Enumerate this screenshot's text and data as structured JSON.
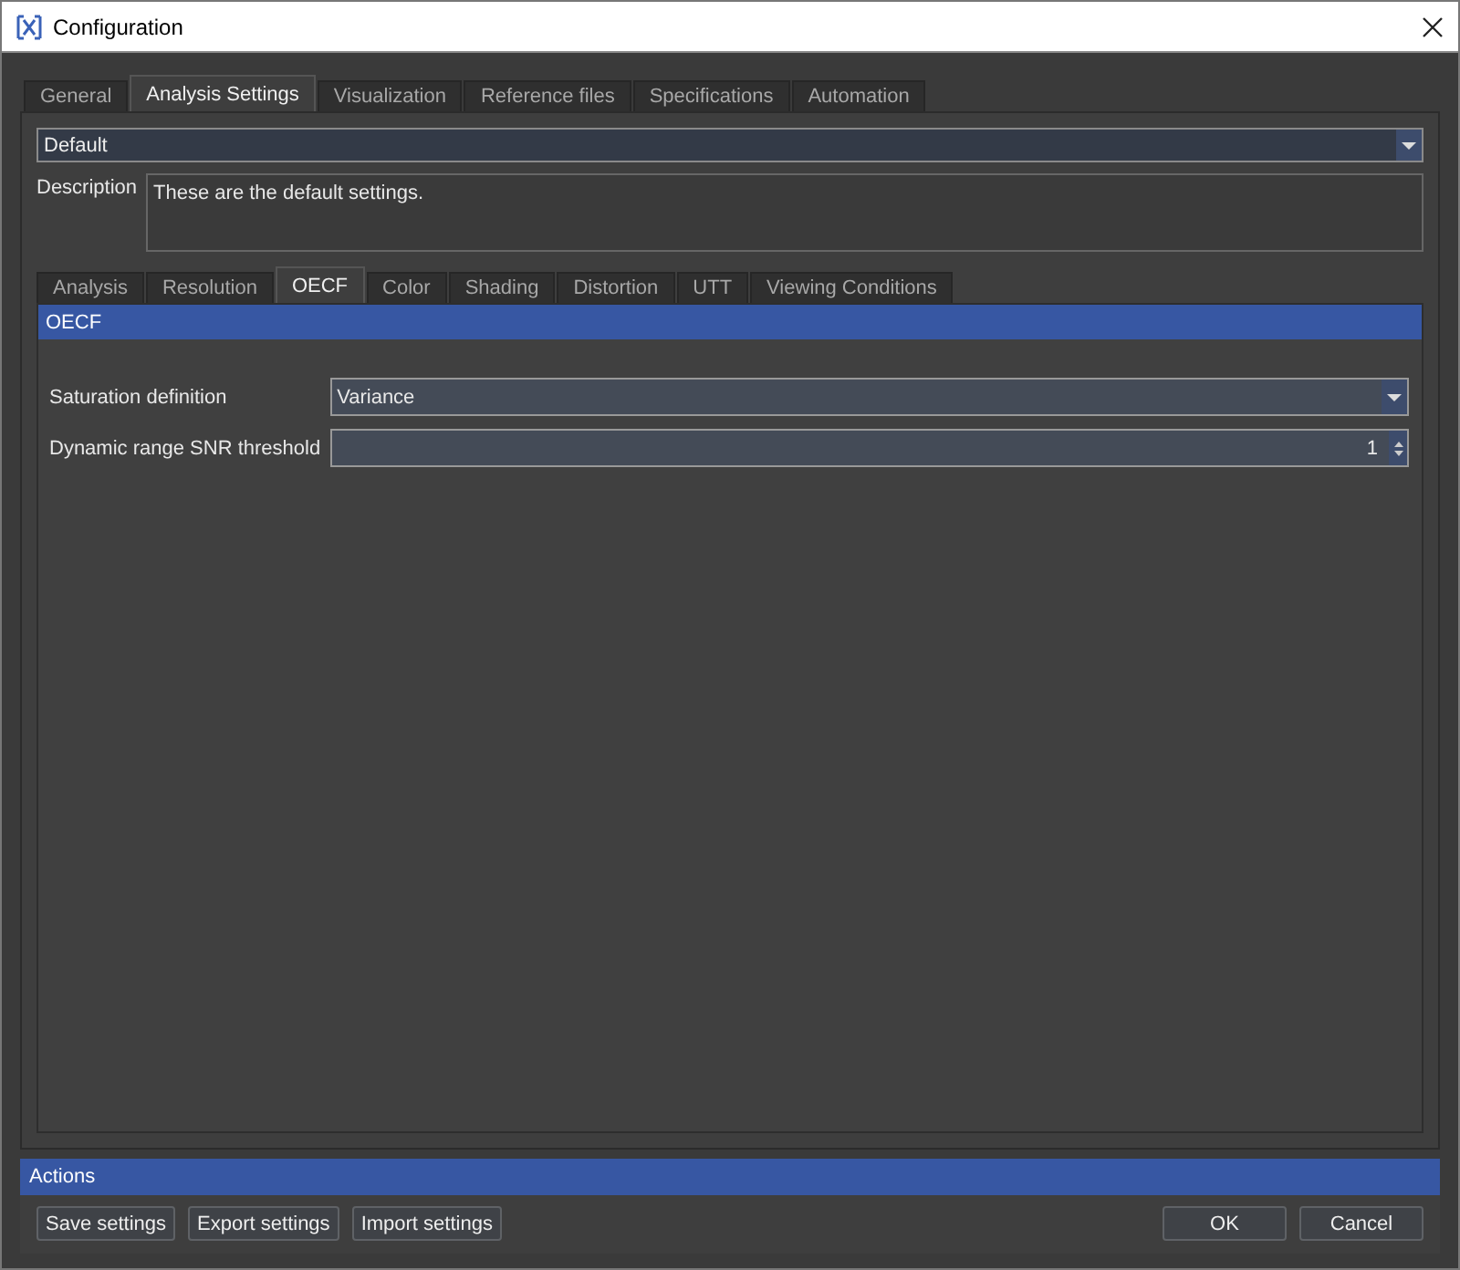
{
  "window": {
    "title": "Configuration"
  },
  "tabs": [
    {
      "label": "General",
      "selected": false
    },
    {
      "label": "Analysis Settings",
      "selected": true
    },
    {
      "label": "Visualization",
      "selected": false
    },
    {
      "label": "Reference files",
      "selected": false
    },
    {
      "label": "Specifications",
      "selected": false
    },
    {
      "label": "Automation",
      "selected": false
    }
  ],
  "preset": {
    "value": "Default"
  },
  "description": {
    "label": "Description",
    "value": "These are the default settings."
  },
  "sub_tabs": [
    {
      "label": "Analysis",
      "selected": false
    },
    {
      "label": "Resolution",
      "selected": false
    },
    {
      "label": "OECF",
      "selected": true
    },
    {
      "label": "Color",
      "selected": false
    },
    {
      "label": "Shading",
      "selected": false
    },
    {
      "label": "Distortion",
      "selected": false
    },
    {
      "label": "UTT",
      "selected": false
    },
    {
      "label": "Viewing Conditions",
      "selected": false
    }
  ],
  "section": {
    "title": "OECF"
  },
  "fields": [
    {
      "kind": "dropdown",
      "label": "Saturation definition",
      "value": "Variance"
    },
    {
      "kind": "spinbox",
      "label": "Dynamic range SNR threshold",
      "value": "1"
    }
  ],
  "actions": {
    "title": "Actions",
    "left_buttons": [
      "Save settings",
      "Export settings",
      "Import settings"
    ],
    "right_buttons": [
      "OK",
      "Cancel"
    ]
  }
}
